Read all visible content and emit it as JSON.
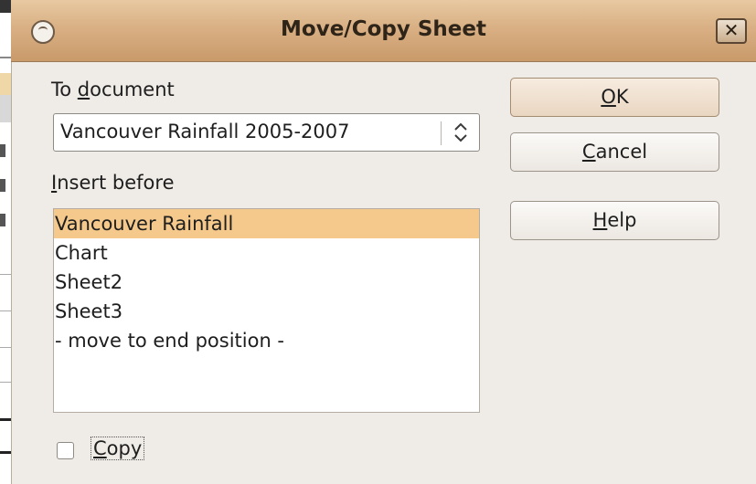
{
  "dialog": {
    "title": "Move/Copy Sheet",
    "close_label": "✕"
  },
  "to_document": {
    "label_prefix": "To ",
    "label_mnemonic": "d",
    "label_rest": "ocument",
    "selected_value": "Vancouver Rainfall 2005-2007"
  },
  "insert_before": {
    "label_mnemonic": "I",
    "label_rest": "nsert before",
    "items": [
      {
        "label": "Vancouver Rainfall",
        "selected": true
      },
      {
        "label": "Chart",
        "selected": false
      },
      {
        "label": "Sheet2",
        "selected": false
      },
      {
        "label": "Sheet3",
        "selected": false
      },
      {
        "label": "- move to end position -",
        "selected": false
      }
    ]
  },
  "buttons": {
    "ok": {
      "mnemonic": "O",
      "rest": "K"
    },
    "cancel": {
      "mnemonic": "C",
      "rest": "ancel"
    },
    "help": {
      "mnemonic": "H",
      "rest": "elp"
    }
  },
  "copy": {
    "mnemonic": "C",
    "rest": "opy",
    "checked": false
  },
  "colors": {
    "titlebar": "#d9b084",
    "selection": "#f4c98b",
    "dialog_bg": "#efebe7"
  }
}
